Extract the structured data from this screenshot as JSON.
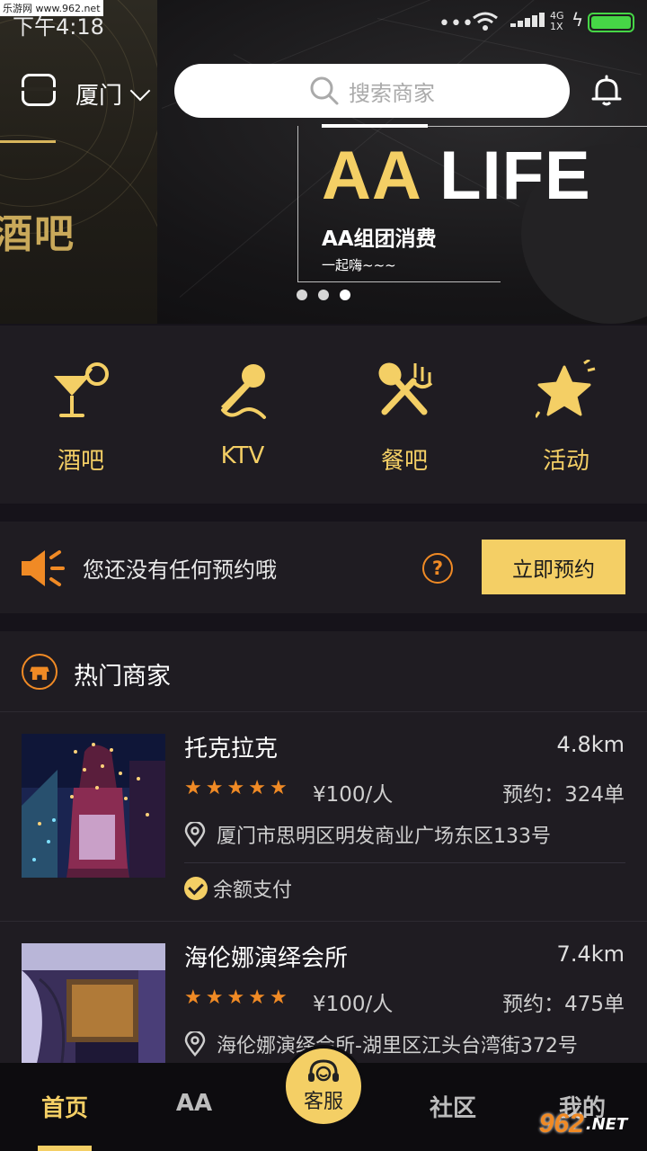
{
  "status_bar": {
    "time": "下午4:18",
    "network": "4G 1X",
    "watermark": "乐游网 www.962.net"
  },
  "header": {
    "city": "厦门",
    "search_placeholder": "搜索商家"
  },
  "banner": {
    "left_text": "酒吧",
    "headline_a": "AA",
    "headline_b": "LIFE",
    "subtitle": "AA组团消费",
    "tagline": "一起嗨~~~",
    "slide_count": 3,
    "active_slide": 3
  },
  "categories": [
    {
      "label": "酒吧",
      "icon": "cocktail-icon"
    },
    {
      "label": "KTV",
      "icon": "microphone-icon"
    },
    {
      "label": "餐吧",
      "icon": "utensils-icon"
    },
    {
      "label": "活动",
      "icon": "star-icon"
    }
  ],
  "reservation": {
    "message": "您还没有任何预约哦",
    "help": "?",
    "button": "立即预约"
  },
  "hot_section": {
    "title": "热门商家"
  },
  "merchants": [
    {
      "name": "托克拉克",
      "distance": "4.8km",
      "rating": 5,
      "price": "¥100/人",
      "orders": "预约：324单",
      "address": "厦门市思明区明发商业广场东区133号",
      "payment": "余额支付"
    },
    {
      "name": "海伦娜演绎会所",
      "distance": "7.4km",
      "rating": 5,
      "price": "¥100/人",
      "orders": "预约：475单",
      "address": "海伦娜演绎会所-湖里区江头台湾街372号"
    }
  ],
  "tabbar": {
    "home": "首页",
    "aa": "AA",
    "service": "客服",
    "community": "社区",
    "mine": "我的"
  },
  "logo": {
    "brand": "962",
    "suffix": ".NET",
    "caption": "乐游网"
  },
  "colors": {
    "accent": "#f4cf65",
    "orange": "#f08a25",
    "background": "#16131a",
    "panel": "#1f1c22"
  }
}
